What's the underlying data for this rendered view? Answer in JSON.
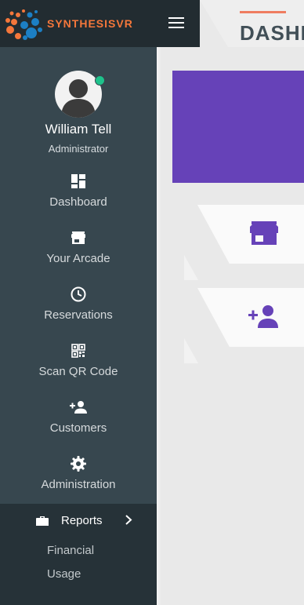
{
  "app": {
    "brand": "SYNTHESISVR",
    "page_title": "DASHB"
  },
  "user": {
    "name": "William Tell",
    "role": "Administrator",
    "status": "online"
  },
  "sidebar": {
    "items": [
      {
        "label": "Dashboard",
        "icon": "dashboard-icon"
      },
      {
        "label": "Your Arcade",
        "icon": "store-icon"
      },
      {
        "label": "Reservations",
        "icon": "clock-icon"
      },
      {
        "label": "Scan QR Code",
        "icon": "qr-code-icon"
      },
      {
        "label": "Customers",
        "icon": "add-person-icon"
      },
      {
        "label": "Administration",
        "icon": "gear-icon"
      }
    ],
    "reports": {
      "label": "Reports",
      "icon": "briefcase-icon",
      "children": [
        "Financial",
        "Usage"
      ]
    }
  },
  "colors": {
    "accent_purple": "#6642b8",
    "brand_orange": "#f4773b",
    "sidebar_bg": "#37474f",
    "online_green": "#1ec28b"
  },
  "cards": [
    {
      "icon": "store-icon"
    },
    {
      "icon": "add-person-icon"
    }
  ]
}
